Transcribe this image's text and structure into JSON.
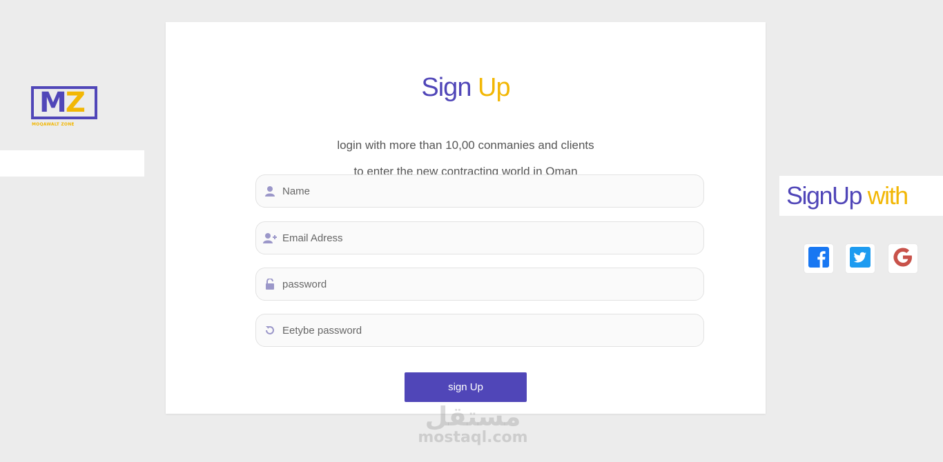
{
  "logo": {
    "letters_m": "M",
    "letters_z": "Z",
    "tagline": "MOQAWALT ZONE"
  },
  "signup": {
    "title_part1": "Sign",
    "title_part2": "Up",
    "subtitle_line1": "login with more than 10,00 conmanies and clients",
    "subtitle_line2": "to enter the new contracting world in Oman",
    "fields": [
      {
        "placeholder": "Name",
        "icon": "user-icon"
      },
      {
        "placeholder": "Email Adress",
        "icon": "user-plus-icon"
      },
      {
        "placeholder": "password",
        "icon": "unlock-icon"
      },
      {
        "placeholder": "Eetybe password",
        "icon": "refresh-icon"
      }
    ],
    "button_label": "sign Up"
  },
  "signup_with": {
    "part1": "SignUp",
    "part2": "with",
    "providers": [
      "facebook-icon",
      "twitter-icon",
      "google-icon"
    ]
  },
  "watermark": {
    "arabic": "مستقل",
    "latin": "mostaql.com"
  },
  "colors": {
    "primary": "#5046b8",
    "accent": "#f2b705",
    "background": "#ececec"
  }
}
